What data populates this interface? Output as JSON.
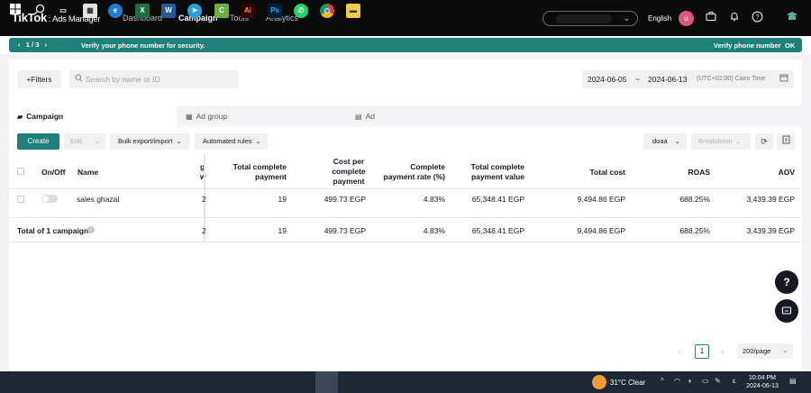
{
  "topnav": {
    "logo": "TikTok",
    "logo_sub": ": Ads Manager",
    "items": [
      "Dashboard",
      "Campaign",
      "Tools",
      "Analytics"
    ],
    "active": "Campaign",
    "language": "English",
    "avatar_letter": "u",
    "icons": [
      "briefcase-icon",
      "bell-icon",
      "help-icon",
      "tutorial-icon"
    ]
  },
  "banner": {
    "pager": "1 / 3",
    "message": "Verify your phone number for security.",
    "action": "Verify phone number",
    "ok": "OK",
    "color": "#1f7f79"
  },
  "toolbar_top": {
    "filters_label": "+Filters",
    "search_placeholder": "Search by name or ID",
    "date_start": "2024-06-05",
    "date_sep": "~",
    "date_end": "2024-06-13",
    "timezone": "(UTC+02:00) Cairo Time"
  },
  "tabs": [
    {
      "label": "Campaign",
      "icon": "folder-icon"
    },
    {
      "label": "Ad group",
      "icon": "grid-icon"
    },
    {
      "label": "Ad",
      "icon": "document-icon"
    }
  ],
  "actions": {
    "create": "Create",
    "edit": "Edit",
    "bulk": "Bulk export/import",
    "rules": "Automated rules",
    "view": "doaa",
    "breakdown": "Breakdown",
    "accent": "#1f7f79"
  },
  "table": {
    "headers": {
      "onoff": "On/Off",
      "name": "Name",
      "partial_a": "g",
      "partial_b": "w",
      "tcp": [
        "Total complete",
        "payment"
      ],
      "cpcp": [
        "Cost per",
        "complete",
        "payment"
      ],
      "cpr": [
        "Complete",
        "payment rate (%)"
      ],
      "tcpv": [
        "Total complete",
        "payment value"
      ],
      "cost": "Total cost",
      "roas": "ROAS",
      "aov": "AOV"
    },
    "row": {
      "name": "sales ghazal",
      "partial": "2",
      "tcp": "19",
      "cpcp": "499.73 EGP",
      "cpr": "4.83%",
      "tcpv": "65,348.41 EGP",
      "cost": "9,494.86 EGP",
      "roas": "688.25%",
      "aov": "3,439.39 EGP"
    },
    "total": {
      "label": "Total of 1 campaign",
      "partial": "2",
      "tcp": "19",
      "cpcp": "499.73 EGP",
      "cpr": "4.83%",
      "tcpv": "65,348.41 EGP",
      "cost": "9,494.86 EGP",
      "roas": "688.25%",
      "aov": "3,439.39 EGP"
    }
  },
  "pagination": {
    "page": "1",
    "page_size": "200/page"
  },
  "taskbar": {
    "weather": "31°C  Clear",
    "time": "10:04 PM",
    "date": "2024-06-13",
    "lang": "ε"
  }
}
